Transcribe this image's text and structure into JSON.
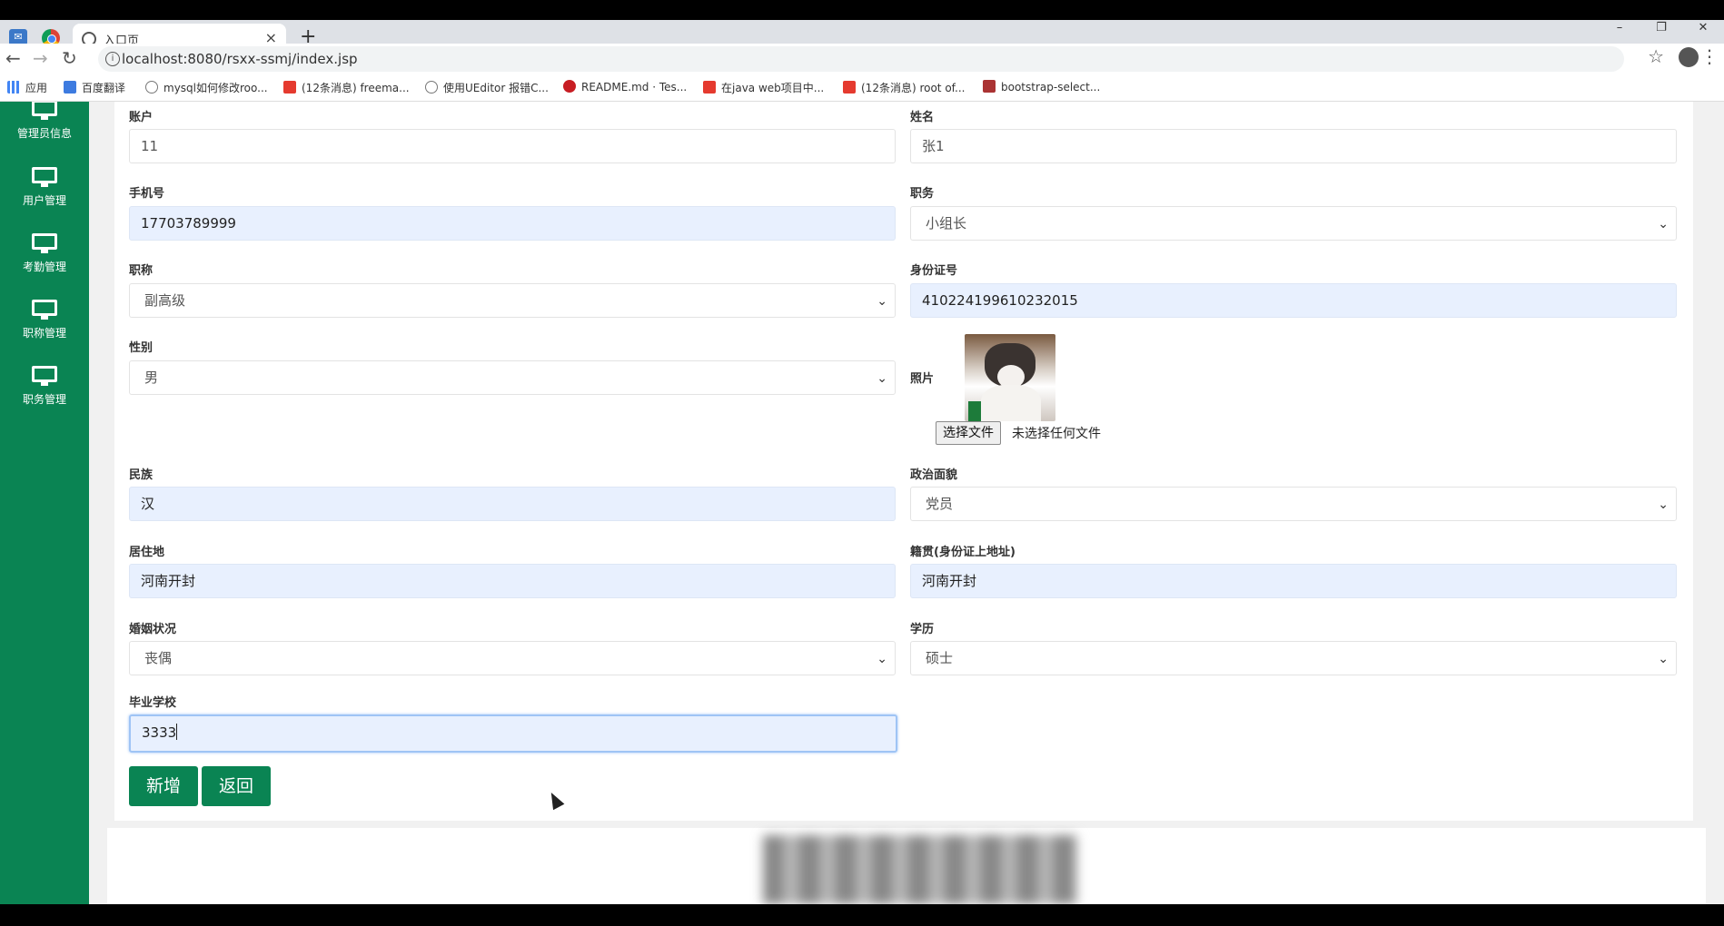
{
  "browser": {
    "tab_title": "入口页",
    "url": "localhost:8080/rsxx-ssmj/index.jsp",
    "bookmarks": [
      "应用",
      "百度翻译",
      "mysql如何修改roo...",
      "(12条消息) freema...",
      "使用UEditor 报错C...",
      "README.md · Tes...",
      "在java web项目中...",
      "(12条消息) root of...",
      "bootstrap-select..."
    ]
  },
  "sidebar": {
    "items": [
      {
        "label": "管理员信息",
        "icon": "monitor-icon"
      },
      {
        "label": "用户管理",
        "icon": "monitor-icon"
      },
      {
        "label": "考勤管理",
        "icon": "monitor-icon"
      },
      {
        "label": "职称管理",
        "icon": "monitor-icon"
      },
      {
        "label": "职务管理",
        "icon": "monitor-icon"
      }
    ]
  },
  "form": {
    "account": {
      "label": "账户",
      "value": "11"
    },
    "name": {
      "label": "姓名",
      "value": "张1"
    },
    "phone": {
      "label": "手机号",
      "value": "17703789999"
    },
    "position": {
      "label": "职务",
      "value": "小组长"
    },
    "title": {
      "label": "职称",
      "value": "副高级"
    },
    "id_card": {
      "label": "身份证号",
      "value": "410224199610232015"
    },
    "gender": {
      "label": "性别",
      "value": "男"
    },
    "photo": {
      "label": "照片",
      "file_button": "选择文件",
      "file_status": "未选择任何文件"
    },
    "ethnicity": {
      "label": "民族",
      "value": "汉"
    },
    "political": {
      "label": "政治面貌",
      "value": "党员"
    },
    "residence": {
      "label": "居住地",
      "value": "河南开封"
    },
    "native_place": {
      "label": "籍贯(身份证上地址)",
      "value": "河南开封"
    },
    "marital": {
      "label": "婚姻状况",
      "value": "丧偶"
    },
    "education": {
      "label": "学历",
      "value": "硕士"
    },
    "school": {
      "label": "毕业学校",
      "value": "3333"
    },
    "buttons": {
      "add": "新增",
      "back": "返回"
    }
  },
  "colors": {
    "sidebar": "#0a8453",
    "button": "#0a8453",
    "autofill": "#e8f0fe"
  }
}
